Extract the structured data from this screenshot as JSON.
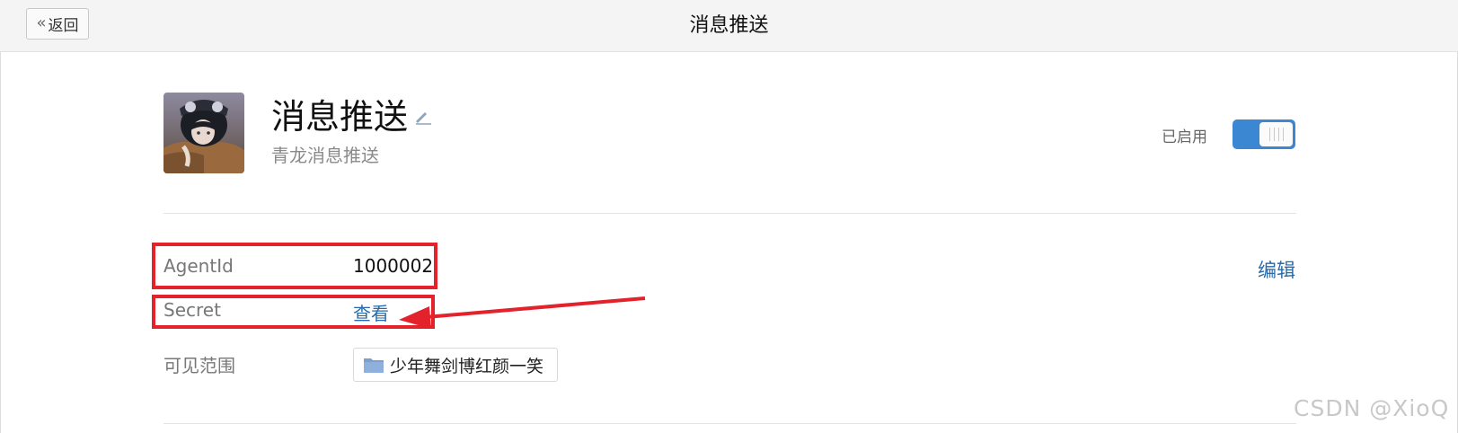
{
  "topbar": {
    "back_label": "返回",
    "title": "消息推送"
  },
  "app": {
    "name": "消息推送",
    "description": "青龙消息推送",
    "status_label": "已启用",
    "toggle_on": true,
    "accent_color": "#3b87d1"
  },
  "details": {
    "agent_id_label": "AgentId",
    "agent_id_value": "1000002",
    "secret_label": "Secret",
    "secret_action": "查看",
    "scope_label": "可见范围",
    "scope_value": "少年舞剑博红颜一笑",
    "edit_label": "编辑"
  },
  "annotation": {
    "highlight_color": "#e3222b"
  },
  "watermark": "CSDN @XioQ"
}
